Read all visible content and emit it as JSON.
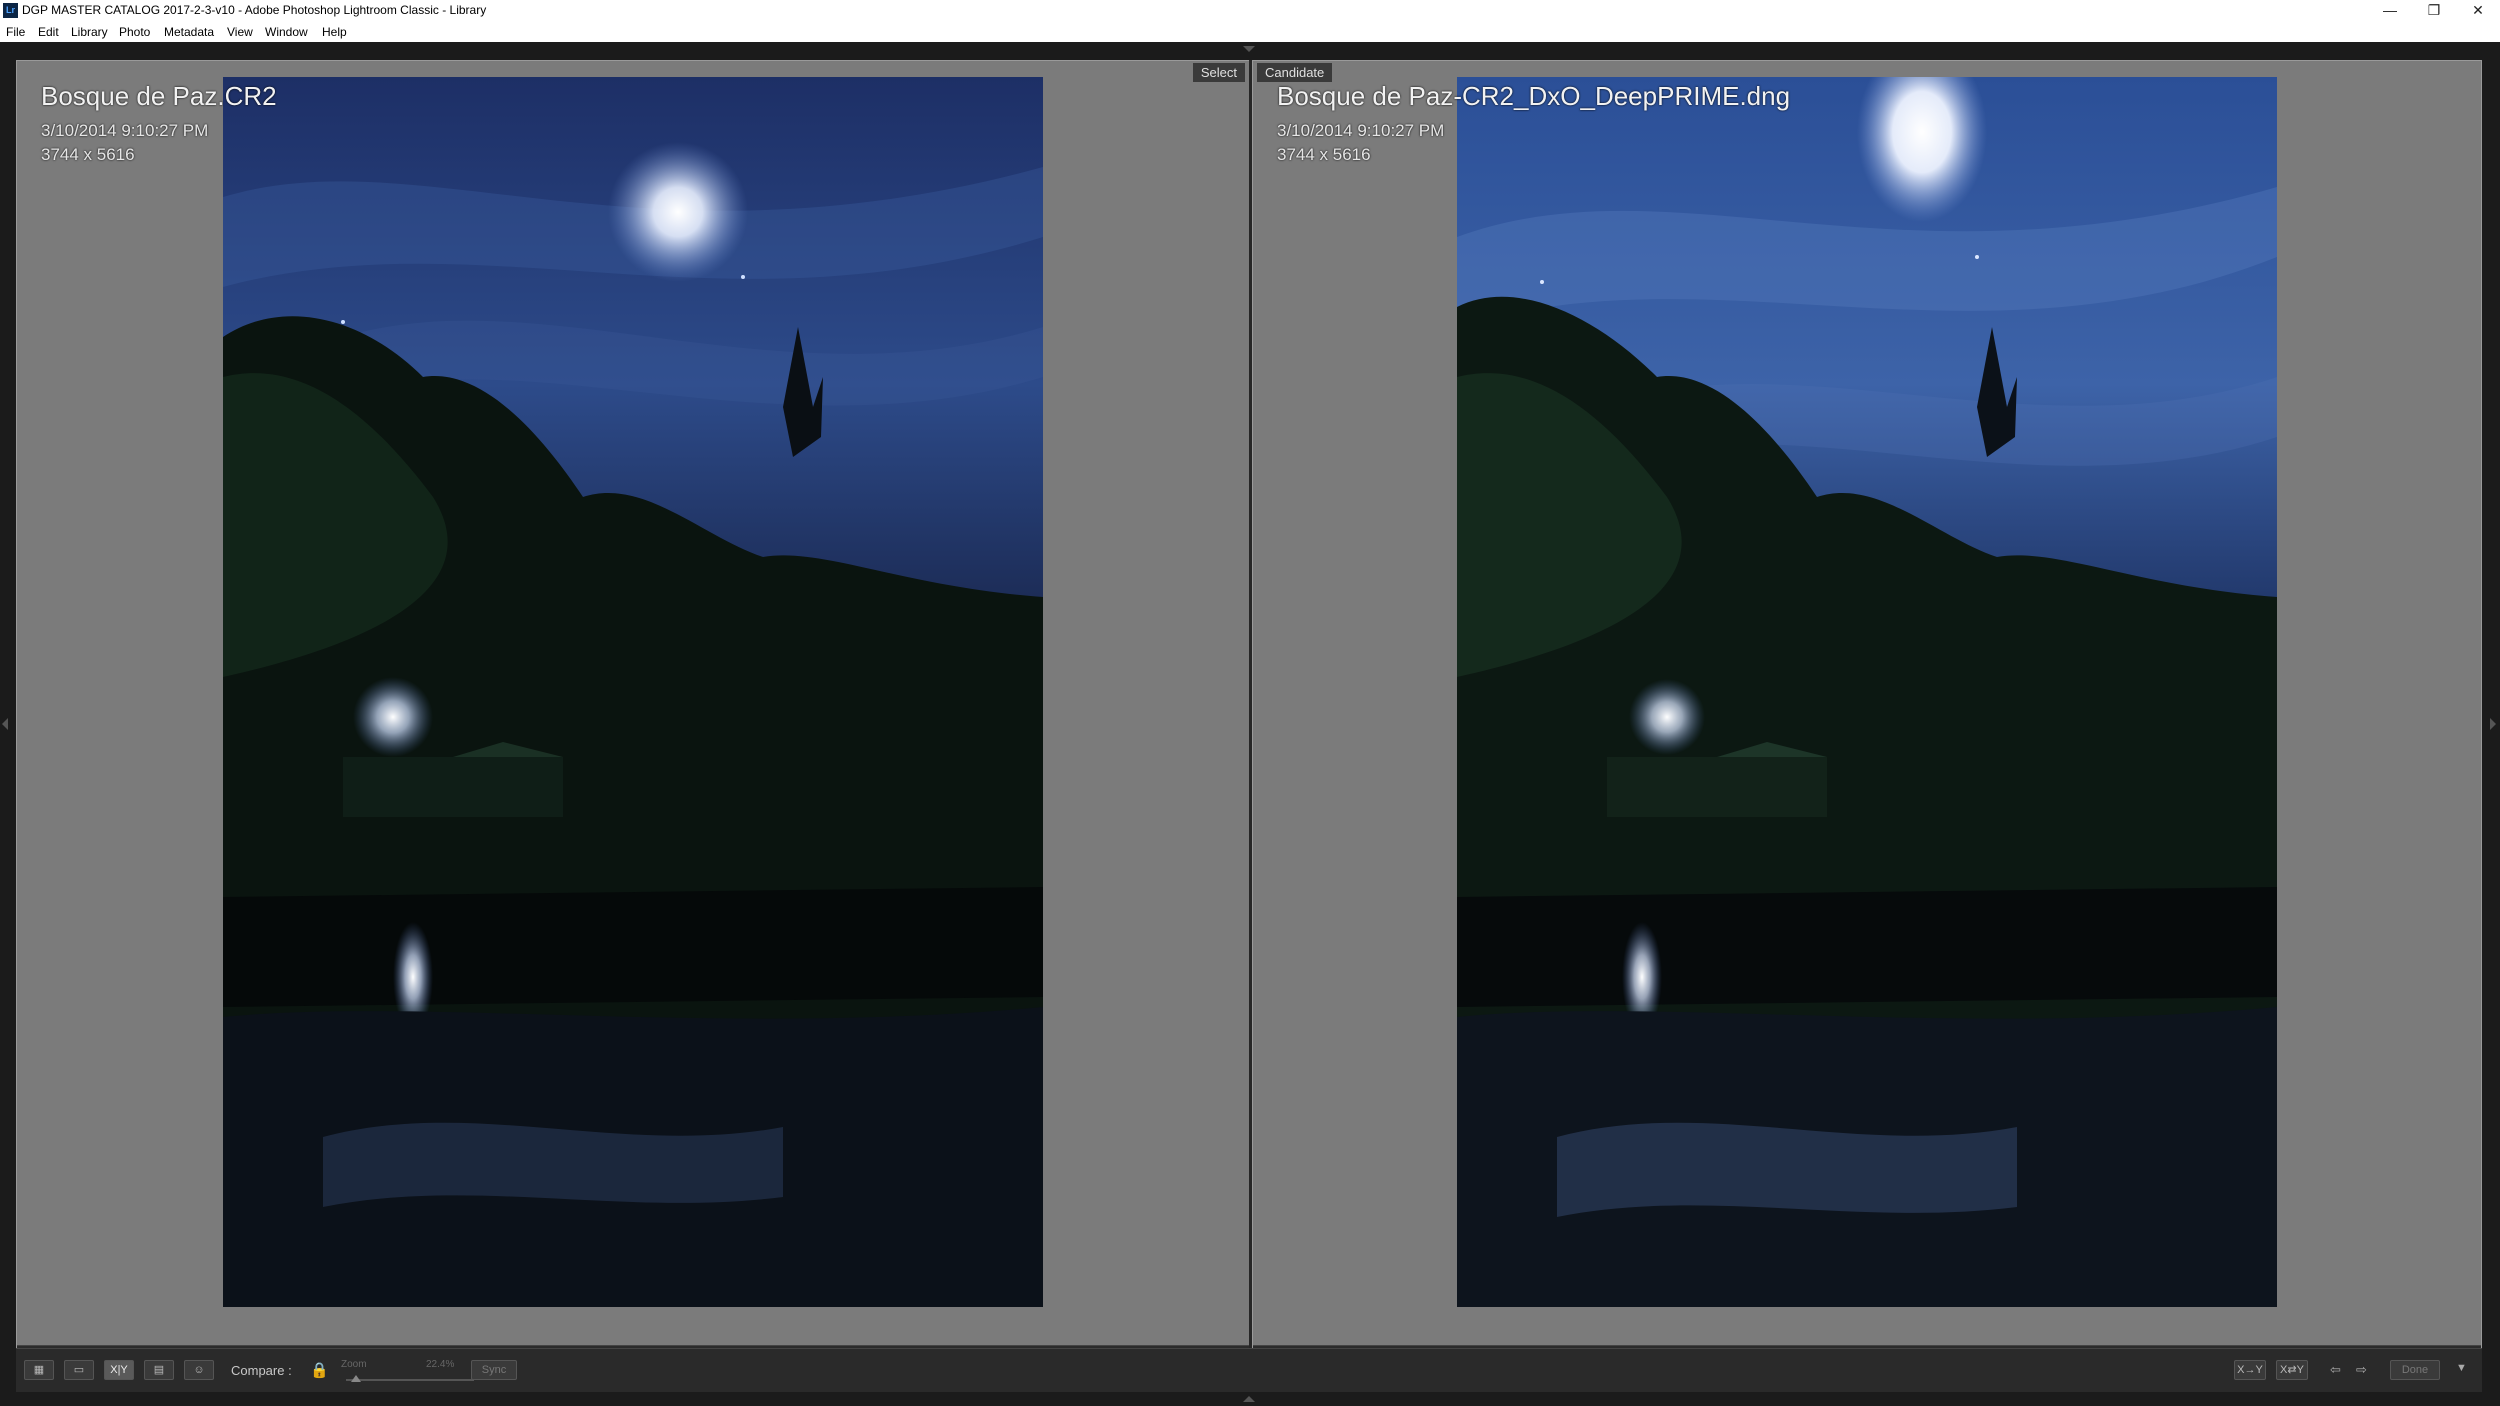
{
  "window": {
    "app_icon": "Lr",
    "title": "DGP MASTER CATALOG 2017-2-3-v10 - Adobe Photoshop Lightroom Classic - Library",
    "minimize_icon": "minimize-icon",
    "restore_icon": "restore-icon",
    "close_icon": "close-icon"
  },
  "menu": [
    "File",
    "Edit",
    "Library",
    "Photo",
    "Metadata",
    "View",
    "Window",
    "Help"
  ],
  "select_pane": {
    "label": "Select",
    "filename": "Bosque de Paz.CR2",
    "datetime": "3/10/2014 9:10:27 PM",
    "dimensions": "3744 x 5616",
    "stars": "★★★★·"
  },
  "candidate_pane": {
    "label": "Candidate",
    "filename": "Bosque de Paz-CR2_DxO_DeepPRIME.dng",
    "datetime": "3/10/2014 9:10:27 PM",
    "dimensions": "3744 x 5616",
    "stars": "★★★★·"
  },
  "toolbar": {
    "compare_label": "Compare :",
    "zoom_label": "Zoom",
    "zoom_value": "22.4%",
    "sync_label": "Sync",
    "xy_label": "X|Y",
    "done_label": "Done",
    "swap_label": "X⇄Y",
    "make_select_label": "X→Y",
    "close_glyph": "×"
  },
  "colors": {
    "background": "#7b7b7b",
    "toolbar": "#2a2a2a",
    "sky": "#2e4a86",
    "moon": "#ffffff"
  }
}
